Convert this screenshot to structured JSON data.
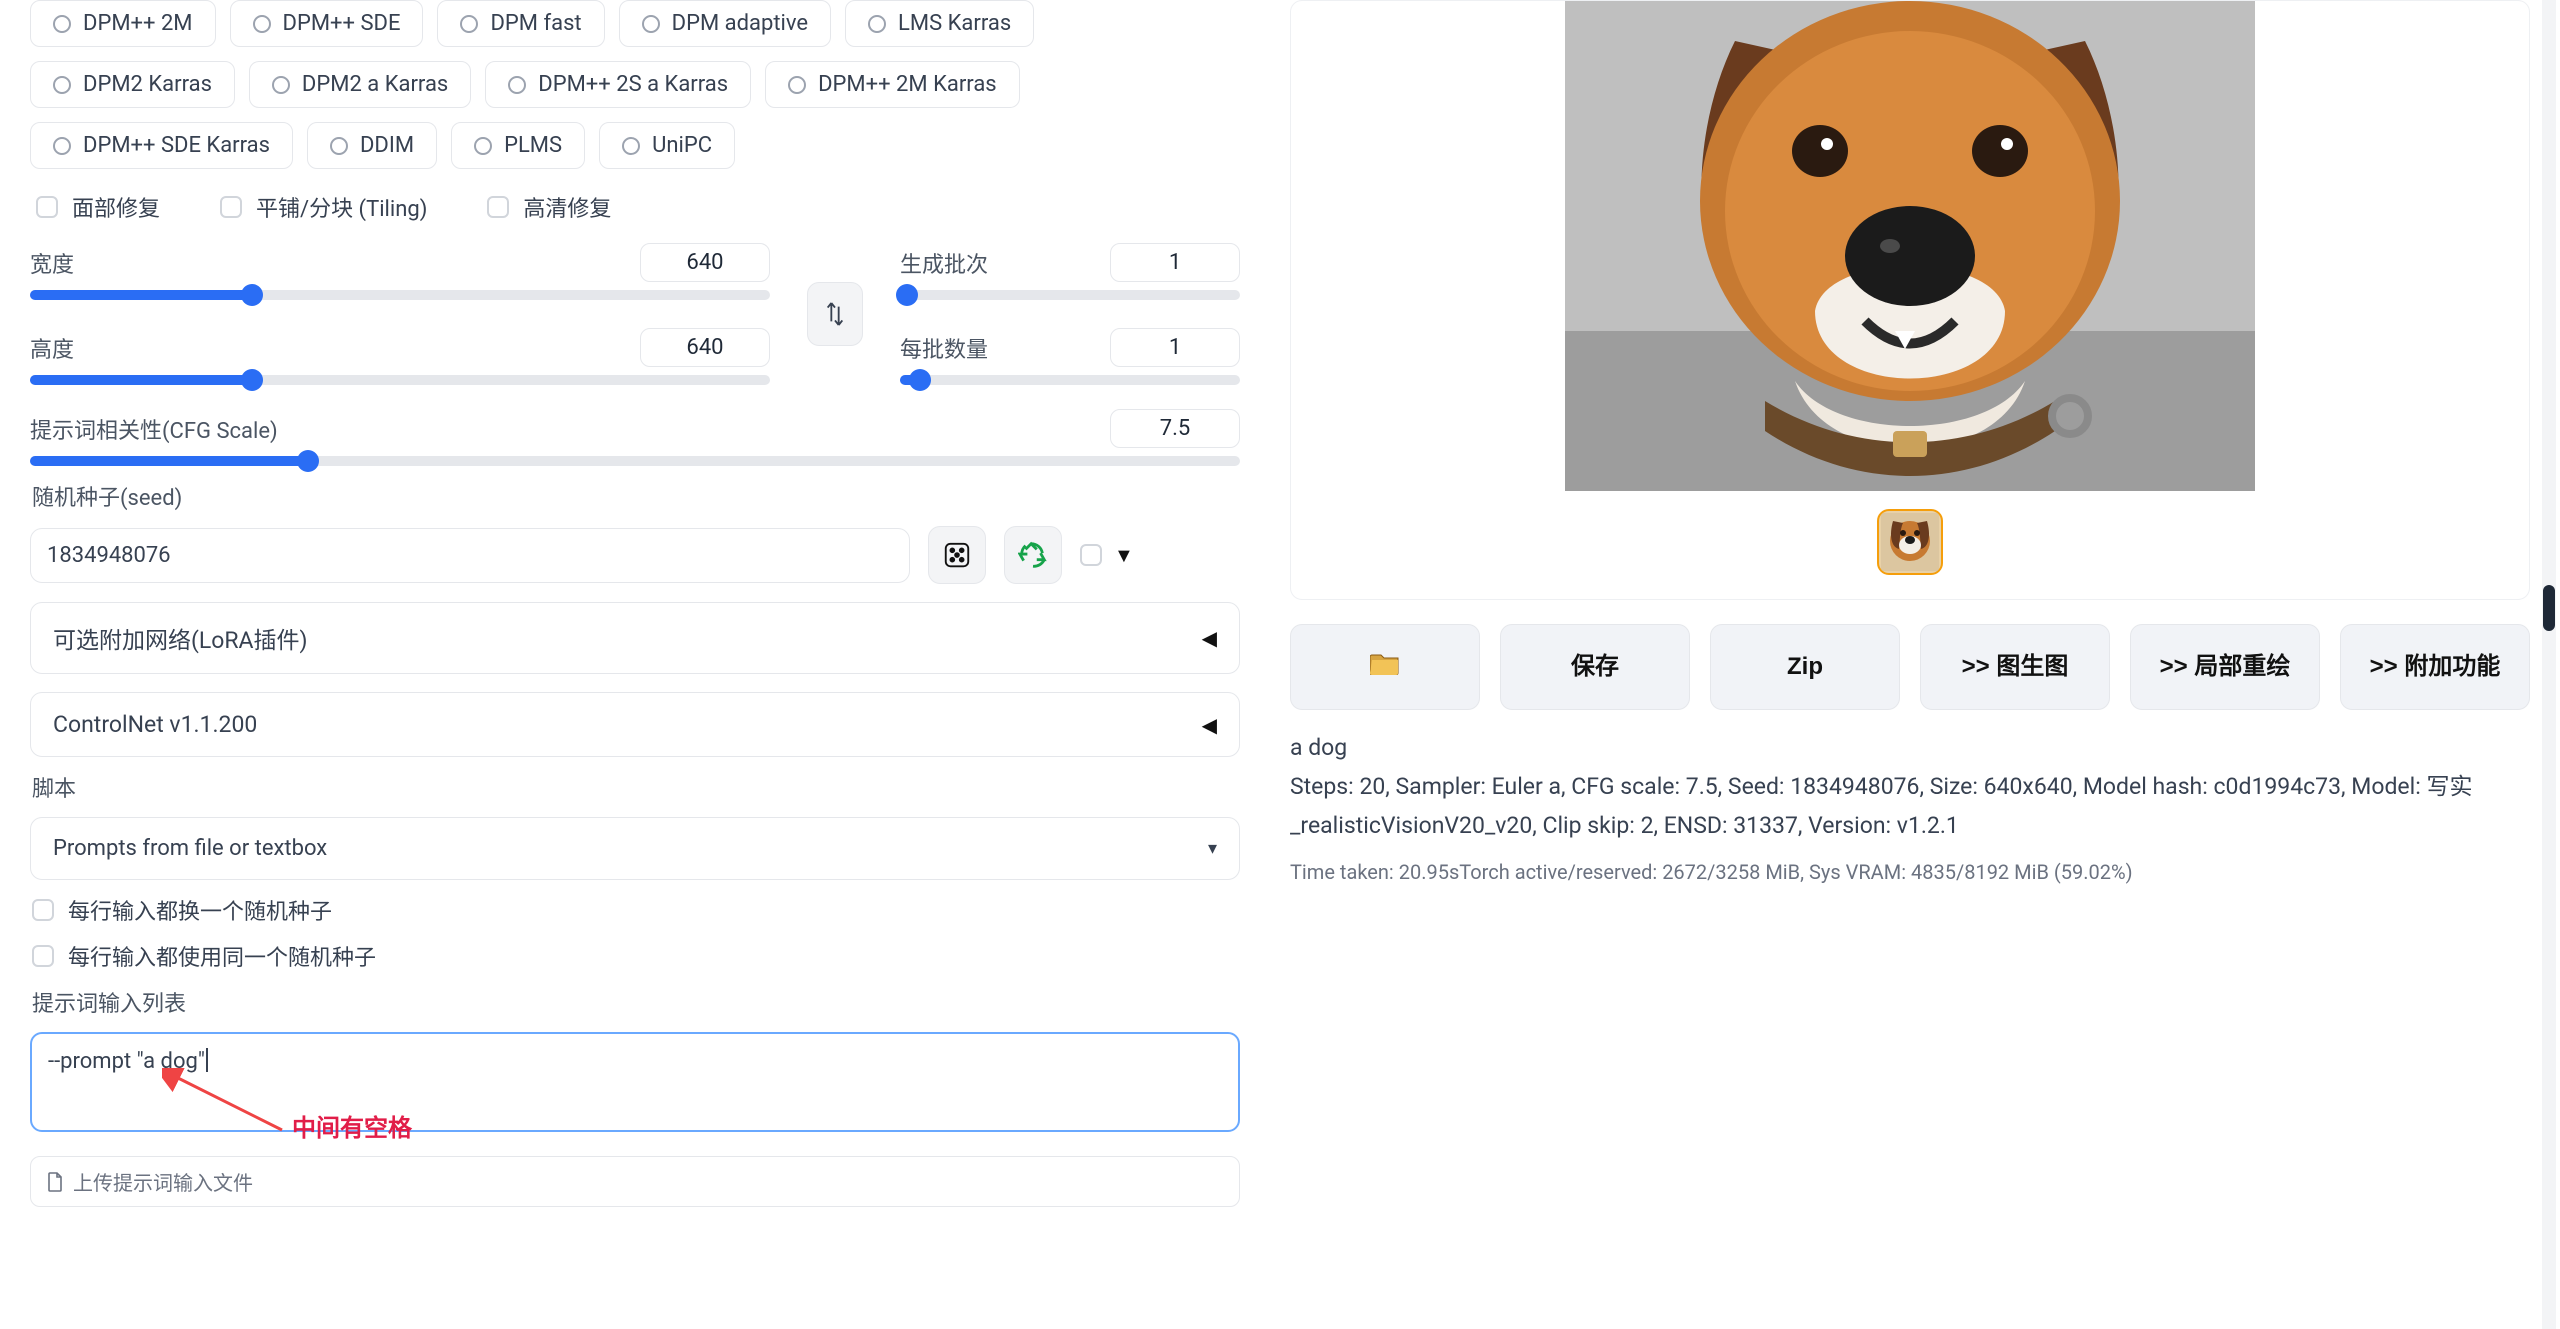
{
  "samplers": [
    "DPM++ 2M",
    "DPM++ SDE",
    "DPM fast",
    "DPM adaptive",
    "LMS Karras",
    "DPM2 Karras",
    "DPM2 a Karras",
    "DPM++ 2S a Karras",
    "DPM++ 2M Karras",
    "DPM++ SDE Karras",
    "DDIM",
    "PLMS",
    "UniPC"
  ],
  "checks": {
    "face": "面部修复",
    "tiling": "平铺/分块 (Tiling)",
    "hires": "高清修复"
  },
  "width": {
    "label": "宽度",
    "value": "640",
    "fillPct": 30
  },
  "height": {
    "label": "高度",
    "value": "640",
    "fillPct": 30
  },
  "batchCount": {
    "label": "生成批次",
    "value": "1",
    "fillPct": 2
  },
  "batchSize": {
    "label": "每批数量",
    "value": "1",
    "fillPct": 6
  },
  "cfg": {
    "label": "提示词相关性(CFG Scale)",
    "value": "7.5",
    "fillPct": 23
  },
  "seed": {
    "label": "随机种子(seed)",
    "value": "1834948076"
  },
  "lora": {
    "title": "可选附加网络(LoRA插件)"
  },
  "controlnet": {
    "title": "ControlNet v1.1.200"
  },
  "script": {
    "label": "脚本",
    "selected": "Prompts from file or textbox"
  },
  "scriptOptions": {
    "iterateSeed": "每行输入都换一个随机种子",
    "sameSeed": "每行输入都使用同一个随机种子",
    "listLabel": "提示词输入列表",
    "textboxValue": "--prompt \"a dog\"",
    "annotation": "中间有空格",
    "upload": "上传提示词输入文件"
  },
  "result": {
    "prompt": "a dog",
    "line1": "Steps: 20, Sampler: Euler a, CFG scale: 7.5, Seed: 1834948076, Size: 640x640, Model hash: c0d1994c73, Model: 写实_realisticVisionV20_v20, Clip skip: 2, ENSD: 31337, Version: v1.2.1",
    "meta": "Time taken: 20.95sTorch active/reserved: 2672/3258 MiB, Sys VRAM: 4835/8192 MiB (59.02%)"
  },
  "actions": {
    "save": "保存",
    "zip": "Zip",
    "img2img": ">> 图生图",
    "inpaint": ">> 局部重绘",
    "extras": ">> 附加功能"
  }
}
